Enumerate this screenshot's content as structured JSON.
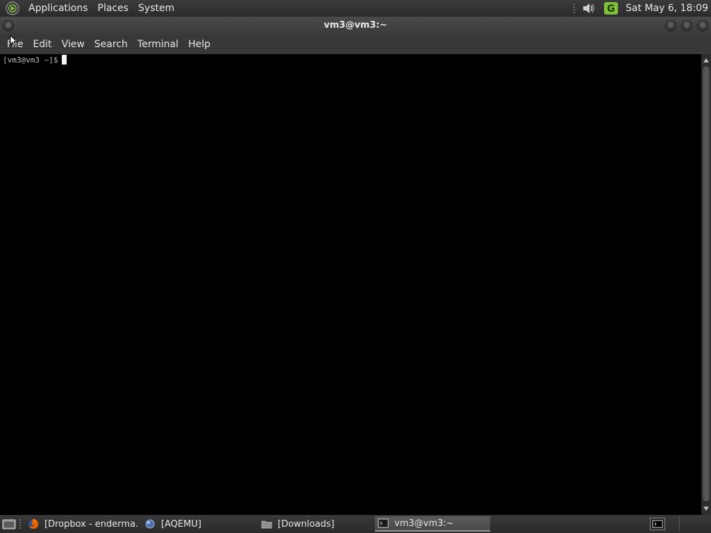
{
  "top_panel": {
    "menus": [
      "Applications",
      "Places",
      "System"
    ],
    "clock": "Sat May  6, 18:09",
    "icons": [
      "distro-logo-icon",
      "volume-icon",
      "update-notifier-icon"
    ]
  },
  "window": {
    "title": "vm3@vm3:~",
    "menubar": [
      "File",
      "Edit",
      "View",
      "Search",
      "Terminal",
      "Help"
    ]
  },
  "terminal": {
    "prompt": "[vm3@vm3 ~]$"
  },
  "taskbar": {
    "tasks": [
      {
        "label": "[Dropbox - enderma…",
        "icon": "firefox-icon",
        "active": false
      },
      {
        "label": "[AQEMU]",
        "icon": "aqemu-icon",
        "active": false
      },
      {
        "label": "[Downloads]",
        "icon": "folder-icon",
        "active": false
      },
      {
        "label": "vm3@vm3:~",
        "icon": "terminal-icon",
        "active": true
      }
    ]
  },
  "colors": {
    "panel_bg": "#2f2f2f",
    "terminal_bg": "#000000",
    "accent_green": "#7fc13b"
  }
}
